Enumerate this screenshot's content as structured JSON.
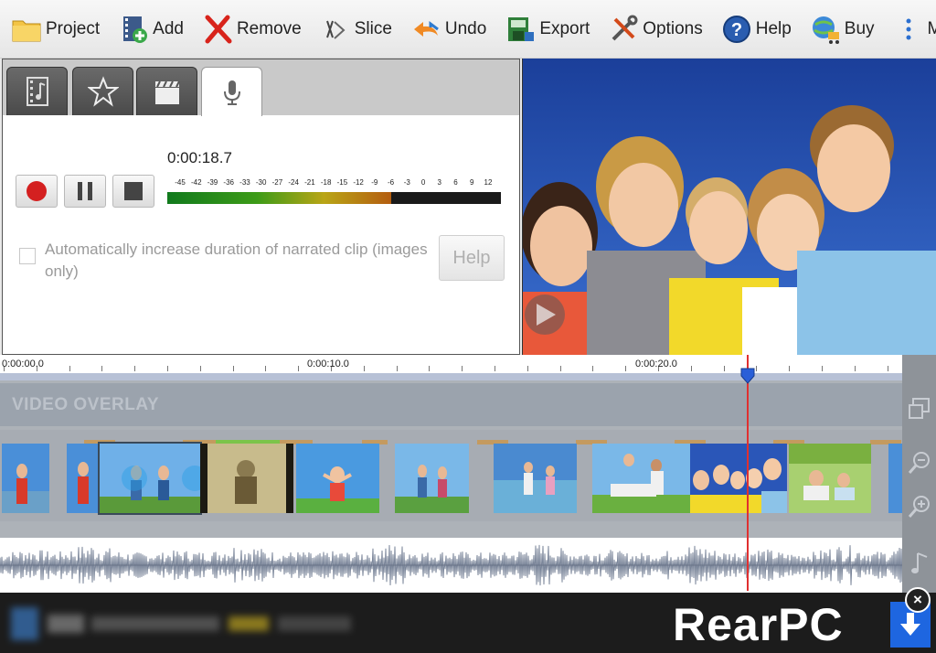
{
  "toolbar": {
    "items": [
      {
        "label": "Project",
        "icon": "folder-icon"
      },
      {
        "label": "Add",
        "icon": "add-film-icon"
      },
      {
        "label": "Remove",
        "icon": "remove-x-icon"
      },
      {
        "label": "Slice",
        "icon": "slice-icon"
      },
      {
        "label": "Undo",
        "icon": "undo-arrow-icon"
      },
      {
        "label": "Export",
        "icon": "export-icon"
      },
      {
        "label": "Options",
        "icon": "tools-icon"
      },
      {
        "label": "Help",
        "icon": "help-icon"
      },
      {
        "label": "Buy",
        "icon": "globe-cart-icon"
      },
      {
        "label": "More",
        "icon": "more-vertical-icon"
      }
    ]
  },
  "narration": {
    "tabs": [
      {
        "icon": "film-music-icon",
        "active": false
      },
      {
        "icon": "star-icon",
        "active": false
      },
      {
        "icon": "clapperboard-icon",
        "active": false
      },
      {
        "icon": "microphone-icon",
        "active": true
      }
    ],
    "elapsed": "0:00:18.7",
    "meter_scale": [
      "-45",
      "-42",
      "-39",
      "-36",
      "-33",
      "-30",
      "-27",
      "-24",
      "-21",
      "-18",
      "-15",
      "-12",
      "-9",
      "-6",
      "-3",
      "0",
      "3",
      "6",
      "9",
      "12"
    ],
    "meter_level_db": -6,
    "auto_duration_label": "Automatically increase duration of narrated clip (images only)",
    "auto_duration_checked": false,
    "help_label": "Help"
  },
  "timeline": {
    "time_labels": [
      "0:00:00.0",
      "0:00:10.0",
      "0:00:20.0"
    ],
    "overlay_label": "VIDEO OVERLAY"
  },
  "ad": {
    "watermark": "RearPC",
    "close": "×"
  },
  "colors": {
    "accent_blue": "#1e66e0",
    "playhead_red": "#e03030",
    "record_red": "#d42020"
  }
}
